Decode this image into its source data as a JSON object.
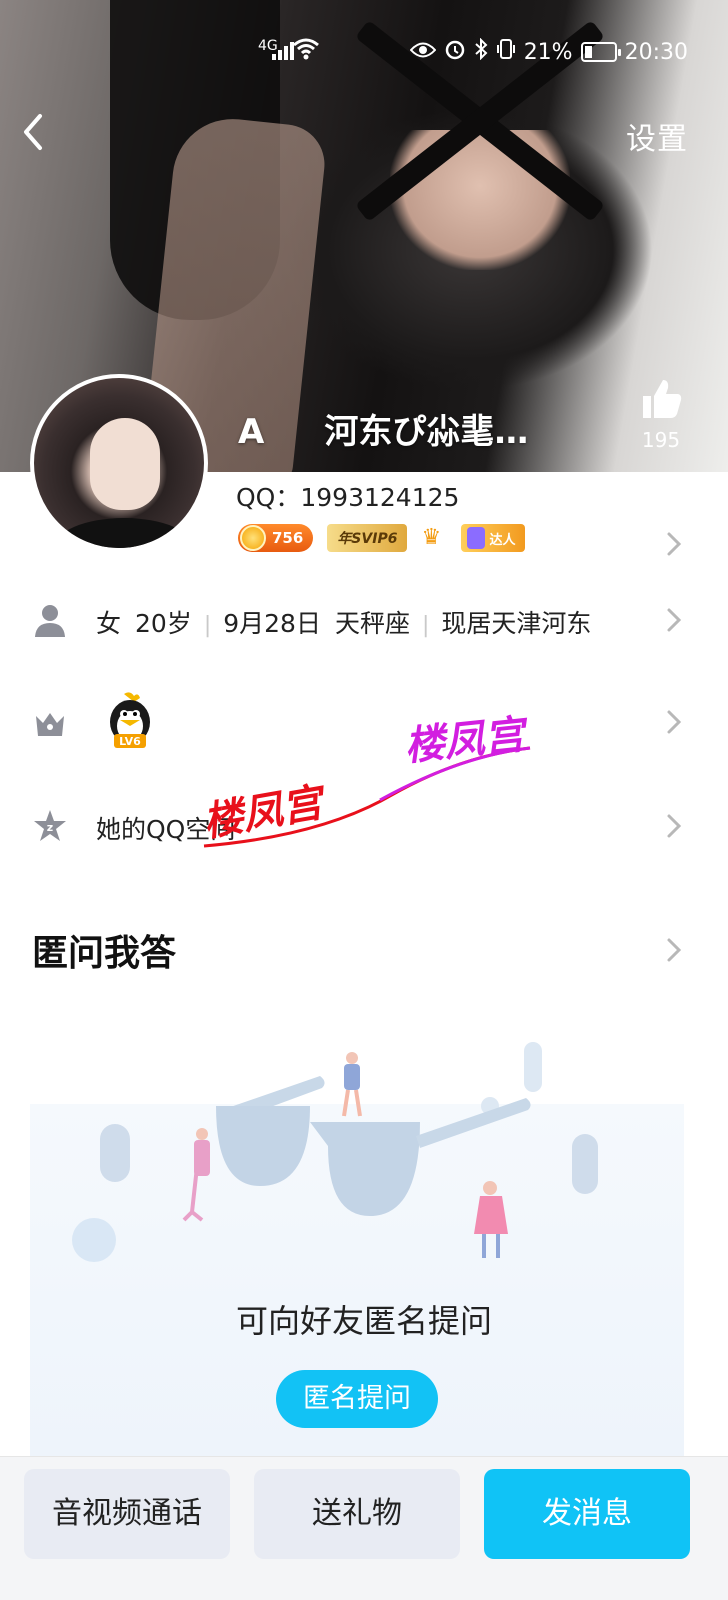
{
  "status_bar": {
    "network": "4G",
    "battery": "21%",
    "time": "20:30"
  },
  "header": {
    "settings_label": "设置",
    "nickname_first": "A",
    "nickname_rest": "河东ぴ尛靟…",
    "like_count": "195"
  },
  "profile": {
    "qq_label": "QQ：",
    "qq_number": "1993124125",
    "badges": {
      "coin_level": "756",
      "svip_text": "年SVIP6",
      "expert_text": "达人"
    },
    "info": {
      "gender": "女",
      "age": "20岁",
      "birthday": "9月28日",
      "zodiac": "天秤座",
      "location": "现居天津河东"
    },
    "level_badge": "LV6",
    "space_label": "她的QQ空间"
  },
  "watermark": {
    "text1": "楼凤宫",
    "text2": "楼凤宫"
  },
  "qa": {
    "title": "匿问我答",
    "hint": "可向好友匿名提问",
    "ask_button": "匿名提问"
  },
  "bottom_bar": {
    "call_label": "音视频通话",
    "gift_label": "送礼物",
    "message_label": "发消息"
  },
  "colors": {
    "accent": "#12c2f5",
    "chevron": "#b8b8b8",
    "icon_gray": "#8d8f98"
  }
}
